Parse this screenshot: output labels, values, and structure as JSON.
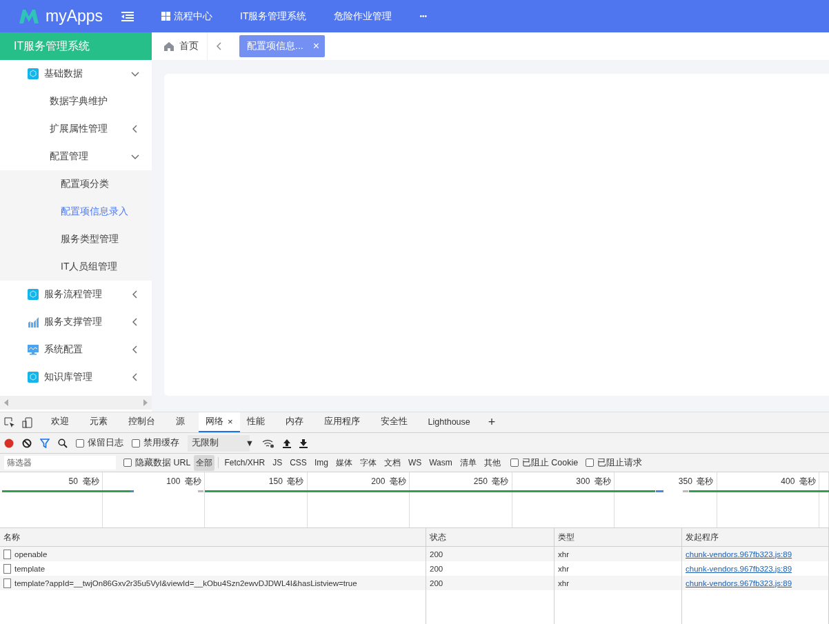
{
  "top_bar": {
    "logo_text": "myApps",
    "nav": [
      {
        "label": "流程中心",
        "kind": "grid"
      },
      {
        "label": "IT服务管理系统",
        "kind": "plain"
      },
      {
        "label": "危险作业管理",
        "kind": "plain"
      },
      {
        "label": "•••",
        "kind": "more"
      }
    ]
  },
  "sidebar": {
    "title": "IT服务管理系统",
    "items": [
      {
        "label": "基础数据",
        "expanded": true,
        "children": [
          {
            "label": "数据字典维护"
          },
          {
            "label": "扩展属性管理",
            "expanded": false
          },
          {
            "label": "配置管理",
            "expanded": true,
            "children": [
              {
                "label": "配置项分类",
                "selected": false
              },
              {
                "label": "配置项信息录入",
                "selected": true
              },
              {
                "label": "服务类型管理",
                "selected": false
              },
              {
                "label": "IT人员组管理",
                "selected": false
              }
            ]
          }
        ]
      },
      {
        "label": "服务流程管理",
        "expanded": false
      },
      {
        "label": "服务支撑管理",
        "expanded": false
      },
      {
        "label": "系统配置",
        "expanded": false
      },
      {
        "label": "知识库管理",
        "expanded": false
      }
    ]
  },
  "tabs_bar": {
    "home": "首页",
    "tabs": [
      {
        "label": "配置项信息...",
        "selected": true,
        "close": "×"
      }
    ]
  },
  "devtools": {
    "tabs": [
      {
        "label": "欢迎",
        "selected": false
      },
      {
        "label": "元素",
        "selected": false
      },
      {
        "label": "控制台",
        "selected": false
      },
      {
        "label": "源",
        "selected": false
      },
      {
        "label": "网络",
        "selected": true,
        "close": "×"
      },
      {
        "label": "性能",
        "selected": false
      },
      {
        "label": "内存",
        "selected": false
      },
      {
        "label": "应用程序",
        "selected": false
      },
      {
        "label": "安全性",
        "selected": false
      },
      {
        "label": "Lighthouse",
        "selected": false
      }
    ],
    "add": "+",
    "toolbar": {
      "checkboxes": [
        {
          "label": "保留日志",
          "checked": false
        },
        {
          "label": "禁用缓存",
          "checked": false
        }
      ],
      "throttle": "无限制",
      "caret": "▼"
    },
    "filter": {
      "placeholder": "筛选器",
      "hide_data_urls": {
        "label": "隐藏数据 URL",
        "checked": false
      },
      "types": [
        {
          "label": "全部",
          "selected": true
        },
        {
          "label": "Fetch/XHR",
          "selected": false
        },
        {
          "label": "JS",
          "selected": false
        },
        {
          "label": "CSS",
          "selected": false
        },
        {
          "label": "Img",
          "selected": false
        },
        {
          "label": "媒体",
          "selected": false
        },
        {
          "label": "字体",
          "selected": false
        },
        {
          "label": "文档",
          "selected": false
        },
        {
          "label": "WS",
          "selected": false
        },
        {
          "label": "Wasm",
          "selected": false
        },
        {
          "label": "清单",
          "selected": false
        },
        {
          "label": "其他",
          "selected": false
        }
      ],
      "extra": [
        {
          "label": "已阻止 Cookie",
          "checked": false
        },
        {
          "label": "已阻止请求",
          "checked": false
        }
      ]
    },
    "timeline_ticks": [
      "50  毫秒",
      "100  毫秒",
      "150  毫秒",
      "200  毫秒",
      "250  毫秒",
      "300  毫秒",
      "350  毫秒",
      "400  毫秒"
    ],
    "table": {
      "columns": [
        "名称",
        "状态",
        "类型",
        "发起程序"
      ],
      "rows": [
        {
          "name": "openable",
          "status": "200",
          "type": "xhr",
          "initiator": "chunk-vendors.967fb323.js:89"
        },
        {
          "name": "template",
          "status": "200",
          "type": "xhr",
          "initiator": "chunk-vendors.967fb323.js:89"
        },
        {
          "name": "template?appId=__twjOn86Gxv2r35u5VyI&viewId=__kObu4Szn2ewvDJDWL4I&hasListview=true",
          "status": "200",
          "type": "xhr",
          "initiator": "chunk-vendors.967fb323.js:89"
        }
      ]
    }
  }
}
